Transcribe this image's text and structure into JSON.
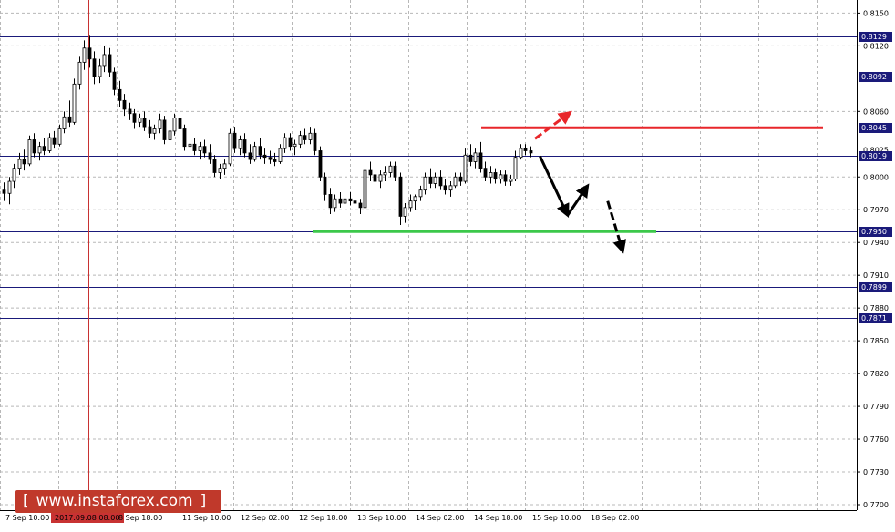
{
  "chart_data": {
    "type": "candlestick",
    "y_ticks": [
      "0.8150",
      "0.8120",
      "0.8060",
      "0.8000",
      "0.7970",
      "0.7940",
      "0.7910",
      "0.7880",
      "0.7850",
      "0.7820",
      "0.7790",
      "0.7760",
      "0.7730",
      "0.7700"
    ],
    "ylim": [
      0.7695,
      0.8162
    ],
    "x_ticks": [
      "7 Sep 10:00",
      "2017.09.08 08:00",
      "8 Sep 18:00",
      "11 Sep 10:00",
      "12 Sep 02:00",
      "12 Sep 18:00",
      "13 Sep 10:00",
      "14 Sep 02:00",
      "14 Sep 18:00",
      "15 Sep 10:00",
      "18 Sep 02:00"
    ],
    "grid": true,
    "crosshair_label": "2017.09.08 08:00",
    "current_price": "0.8025",
    "levels": [
      {
        "value": 0.8129,
        "label": "0.8129"
      },
      {
        "value": 0.8092,
        "label": "0.8092"
      },
      {
        "value": 0.8045,
        "label": "0.8045"
      },
      {
        "value": 0.8019,
        "label": "0.8019"
      },
      {
        "value": 0.795,
        "label": "0.7950"
      },
      {
        "value": 0.7899,
        "label": "0.7899"
      },
      {
        "value": 0.7871,
        "label": "0.7871"
      }
    ],
    "resistance": {
      "value": 0.8045,
      "color": "#e8262a"
    },
    "support": {
      "value": 0.795,
      "color": "#3cc84a"
    },
    "candles": [
      {
        "o": 0.7988,
        "h": 0.7995,
        "l": 0.7978,
        "c": 0.7985
      },
      {
        "o": 0.7985,
        "h": 0.8,
        "l": 0.7975,
        "c": 0.7996
      },
      {
        "o": 0.7996,
        "h": 0.8012,
        "l": 0.799,
        "c": 0.8008
      },
      {
        "o": 0.8008,
        "h": 0.8022,
        "l": 0.8002,
        "c": 0.8016
      },
      {
        "o": 0.8016,
        "h": 0.8025,
        "l": 0.8006,
        "c": 0.8012
      },
      {
        "o": 0.8012,
        "h": 0.8038,
        "l": 0.801,
        "c": 0.8034
      },
      {
        "o": 0.8034,
        "h": 0.804,
        "l": 0.8018,
        "c": 0.8022
      },
      {
        "o": 0.8022,
        "h": 0.8032,
        "l": 0.8015,
        "c": 0.8028
      },
      {
        "o": 0.8028,
        "h": 0.8036,
        "l": 0.802,
        "c": 0.8024
      },
      {
        "o": 0.8024,
        "h": 0.804,
        "l": 0.8022,
        "c": 0.8036
      },
      {
        "o": 0.8036,
        "h": 0.8042,
        "l": 0.8026,
        "c": 0.803
      },
      {
        "o": 0.803,
        "h": 0.8048,
        "l": 0.8028,
        "c": 0.8044
      },
      {
        "o": 0.8044,
        "h": 0.806,
        "l": 0.804,
        "c": 0.8055
      },
      {
        "o": 0.8055,
        "h": 0.807,
        "l": 0.8046,
        "c": 0.805
      },
      {
        "o": 0.805,
        "h": 0.809,
        "l": 0.8048,
        "c": 0.8085
      },
      {
        "o": 0.8085,
        "h": 0.811,
        "l": 0.808,
        "c": 0.8105
      },
      {
        "o": 0.8105,
        "h": 0.8125,
        "l": 0.8098,
        "c": 0.8118
      },
      {
        "o": 0.8118,
        "h": 0.813,
        "l": 0.81,
        "c": 0.8108
      },
      {
        "o": 0.8108,
        "h": 0.8115,
        "l": 0.8085,
        "c": 0.8092
      },
      {
        "o": 0.8092,
        "h": 0.8108,
        "l": 0.8086,
        "c": 0.8102
      },
      {
        "o": 0.8102,
        "h": 0.812,
        "l": 0.8096,
        "c": 0.8112
      },
      {
        "o": 0.8112,
        "h": 0.8118,
        "l": 0.8092,
        "c": 0.8096
      },
      {
        "o": 0.8096,
        "h": 0.81,
        "l": 0.8075,
        "c": 0.808
      },
      {
        "o": 0.808,
        "h": 0.8088,
        "l": 0.8064,
        "c": 0.807
      },
      {
        "o": 0.807,
        "h": 0.8076,
        "l": 0.8056,
        "c": 0.8062
      },
      {
        "o": 0.8062,
        "h": 0.8068,
        "l": 0.8052,
        "c": 0.8058
      },
      {
        "o": 0.8058,
        "h": 0.8062,
        "l": 0.8044,
        "c": 0.805
      },
      {
        "o": 0.805,
        "h": 0.8058,
        "l": 0.8046,
        "c": 0.8054
      },
      {
        "o": 0.8054,
        "h": 0.806,
        "l": 0.8042,
        "c": 0.8046
      },
      {
        "o": 0.8046,
        "h": 0.8052,
        "l": 0.8036,
        "c": 0.804
      },
      {
        "o": 0.804,
        "h": 0.8048,
        "l": 0.8034,
        "c": 0.8044
      },
      {
        "o": 0.8044,
        "h": 0.8058,
        "l": 0.804,
        "c": 0.8052
      },
      {
        "o": 0.8052,
        "h": 0.8056,
        "l": 0.803,
        "c": 0.8034
      },
      {
        "o": 0.8034,
        "h": 0.8046,
        "l": 0.803,
        "c": 0.8042
      },
      {
        "o": 0.8042,
        "h": 0.8058,
        "l": 0.8038,
        "c": 0.8054
      },
      {
        "o": 0.8054,
        "h": 0.806,
        "l": 0.804,
        "c": 0.8044
      },
      {
        "o": 0.8044,
        "h": 0.8048,
        "l": 0.8024,
        "c": 0.8028
      },
      {
        "o": 0.8028,
        "h": 0.8036,
        "l": 0.8018,
        "c": 0.803
      },
      {
        "o": 0.803,
        "h": 0.8036,
        "l": 0.802,
        "c": 0.8024
      },
      {
        "o": 0.8024,
        "h": 0.8032,
        "l": 0.8016,
        "c": 0.8028
      },
      {
        "o": 0.8028,
        "h": 0.8034,
        "l": 0.8018,
        "c": 0.8022
      },
      {
        "o": 0.8022,
        "h": 0.803,
        "l": 0.8012,
        "c": 0.8016
      },
      {
        "o": 0.8016,
        "h": 0.802,
        "l": 0.8,
        "c": 0.8004
      },
      {
        "o": 0.8004,
        "h": 0.8012,
        "l": 0.7998,
        "c": 0.8008
      },
      {
        "o": 0.8008,
        "h": 0.8016,
        "l": 0.8002,
        "c": 0.8012
      },
      {
        "o": 0.8012,
        "h": 0.8044,
        "l": 0.801,
        "c": 0.804
      },
      {
        "o": 0.804,
        "h": 0.8046,
        "l": 0.8022,
        "c": 0.8026
      },
      {
        "o": 0.8026,
        "h": 0.8038,
        "l": 0.802,
        "c": 0.8034
      },
      {
        "o": 0.8034,
        "h": 0.804,
        "l": 0.8018,
        "c": 0.8022
      },
      {
        "o": 0.8022,
        "h": 0.803,
        "l": 0.8012,
        "c": 0.8016
      },
      {
        "o": 0.8016,
        "h": 0.8032,
        "l": 0.8014,
        "c": 0.8028
      },
      {
        "o": 0.8028,
        "h": 0.8036,
        "l": 0.8016,
        "c": 0.802
      },
      {
        "o": 0.802,
        "h": 0.8026,
        "l": 0.8012,
        "c": 0.8018
      },
      {
        "o": 0.8018,
        "h": 0.8024,
        "l": 0.8012,
        "c": 0.8016
      },
      {
        "o": 0.8016,
        "h": 0.8022,
        "l": 0.801,
        "c": 0.8014
      },
      {
        "o": 0.8014,
        "h": 0.803,
        "l": 0.8012,
        "c": 0.8026
      },
      {
        "o": 0.8026,
        "h": 0.804,
        "l": 0.8022,
        "c": 0.8036
      },
      {
        "o": 0.8036,
        "h": 0.804,
        "l": 0.8024,
        "c": 0.8028
      },
      {
        "o": 0.8028,
        "h": 0.8034,
        "l": 0.802,
        "c": 0.803
      },
      {
        "o": 0.803,
        "h": 0.8042,
        "l": 0.8026,
        "c": 0.8038
      },
      {
        "o": 0.8038,
        "h": 0.8044,
        "l": 0.803,
        "c": 0.8034
      },
      {
        "o": 0.8034,
        "h": 0.8046,
        "l": 0.803,
        "c": 0.804
      },
      {
        "o": 0.804,
        "h": 0.8044,
        "l": 0.802,
        "c": 0.8024
      },
      {
        "o": 0.8024,
        "h": 0.8028,
        "l": 0.7996,
        "c": 0.8
      },
      {
        "o": 0.8,
        "h": 0.8004,
        "l": 0.7978,
        "c": 0.7984
      },
      {
        "o": 0.7984,
        "h": 0.799,
        "l": 0.7966,
        "c": 0.7972
      },
      {
        "o": 0.7972,
        "h": 0.7984,
        "l": 0.7968,
        "c": 0.798
      },
      {
        "o": 0.798,
        "h": 0.7986,
        "l": 0.7972,
        "c": 0.7976
      },
      {
        "o": 0.7976,
        "h": 0.7984,
        "l": 0.7972,
        "c": 0.798
      },
      {
        "o": 0.798,
        "h": 0.7986,
        "l": 0.7974,
        "c": 0.7978
      },
      {
        "o": 0.7978,
        "h": 0.7984,
        "l": 0.797,
        "c": 0.7976
      },
      {
        "o": 0.7976,
        "h": 0.798,
        "l": 0.7966,
        "c": 0.7972
      },
      {
        "o": 0.7972,
        "h": 0.8012,
        "l": 0.797,
        "c": 0.8006
      },
      {
        "o": 0.8006,
        "h": 0.8014,
        "l": 0.7996,
        "c": 0.8002
      },
      {
        "o": 0.8002,
        "h": 0.801,
        "l": 0.799,
        "c": 0.7996
      },
      {
        "o": 0.7996,
        "h": 0.8006,
        "l": 0.799,
        "c": 0.8002
      },
      {
        "o": 0.8002,
        "h": 0.801,
        "l": 0.7996,
        "c": 0.8004
      },
      {
        "o": 0.8004,
        "h": 0.8014,
        "l": 0.8,
        "c": 0.801
      },
      {
        "o": 0.801,
        "h": 0.8014,
        "l": 0.7996,
        "c": 0.8
      },
      {
        "o": 0.8,
        "h": 0.8004,
        "l": 0.7956,
        "c": 0.7964
      },
      {
        "o": 0.7964,
        "h": 0.7976,
        "l": 0.7958,
        "c": 0.7972
      },
      {
        "o": 0.7972,
        "h": 0.7984,
        "l": 0.7968,
        "c": 0.7978
      },
      {
        "o": 0.7978,
        "h": 0.7984,
        "l": 0.797,
        "c": 0.7982
      },
      {
        "o": 0.7982,
        "h": 0.7992,
        "l": 0.7978,
        "c": 0.7988
      },
      {
        "o": 0.7988,
        "h": 0.8004,
        "l": 0.7984,
        "c": 0.8
      },
      {
        "o": 0.8,
        "h": 0.8008,
        "l": 0.799,
        "c": 0.7994
      },
      {
        "o": 0.7994,
        "h": 0.8004,
        "l": 0.799,
        "c": 0.8
      },
      {
        "o": 0.8,
        "h": 0.8006,
        "l": 0.7988,
        "c": 0.7992
      },
      {
        "o": 0.7992,
        "h": 0.7998,
        "l": 0.7984,
        "c": 0.7988
      },
      {
        "o": 0.7988,
        "h": 0.7996,
        "l": 0.7982,
        "c": 0.7992
      },
      {
        "o": 0.7992,
        "h": 0.8004,
        "l": 0.799,
        "c": 0.8
      },
      {
        "o": 0.8,
        "h": 0.8004,
        "l": 0.7992,
        "c": 0.7996
      },
      {
        "o": 0.7996,
        "h": 0.8026,
        "l": 0.7994,
        "c": 0.802
      },
      {
        "o": 0.802,
        "h": 0.803,
        "l": 0.801,
        "c": 0.8014
      },
      {
        "o": 0.8014,
        "h": 0.8026,
        "l": 0.8008,
        "c": 0.8022
      },
      {
        "o": 0.8022,
        "h": 0.8032,
        "l": 0.8004,
        "c": 0.8008
      },
      {
        "o": 0.8008,
        "h": 0.8014,
        "l": 0.7996,
        "c": 0.8
      },
      {
        "o": 0.8,
        "h": 0.801,
        "l": 0.7994,
        "c": 0.8004
      },
      {
        "o": 0.8004,
        "h": 0.8008,
        "l": 0.7994,
        "c": 0.7998
      },
      {
        "o": 0.7998,
        "h": 0.8006,
        "l": 0.7994,
        "c": 0.8002
      },
      {
        "o": 0.8002,
        "h": 0.8006,
        "l": 0.7992,
        "c": 0.7996
      },
      {
        "o": 0.7996,
        "h": 0.8002,
        "l": 0.7992,
        "c": 0.7998
      },
      {
        "o": 0.7998,
        "h": 0.8024,
        "l": 0.7996,
        "c": 0.8018
      },
      {
        "o": 0.8018,
        "h": 0.803,
        "l": 0.8016,
        "c": 0.8026
      },
      {
        "o": 0.8026,
        "h": 0.803,
        "l": 0.802,
        "c": 0.8024
      },
      {
        "o": 0.8024,
        "h": 0.8028,
        "l": 0.8018,
        "c": 0.8022
      }
    ],
    "arrows": [
      {
        "from": [
          106,
          0.8035
        ],
        "to": [
          113,
          0.8059
        ],
        "color": "#e8262a",
        "dashed": true
      },
      {
        "from": [
          107,
          0.8019
        ],
        "to": [
          112.5,
          0.7965
        ],
        "color": "#000000",
        "dashed": false
      },
      {
        "from": [
          112.5,
          0.7965
        ],
        "to": [
          116.5,
          0.7992
        ],
        "color": "#000000",
        "dashed": false
      },
      {
        "from": [
          120.5,
          0.7978
        ],
        "to": [
          123.5,
          0.7932
        ],
        "color": "#000000",
        "dashed": true
      }
    ]
  },
  "watermark": {
    "left_bracket": "[",
    "text": "www.instaforex.com",
    "right_bracket": "]"
  }
}
